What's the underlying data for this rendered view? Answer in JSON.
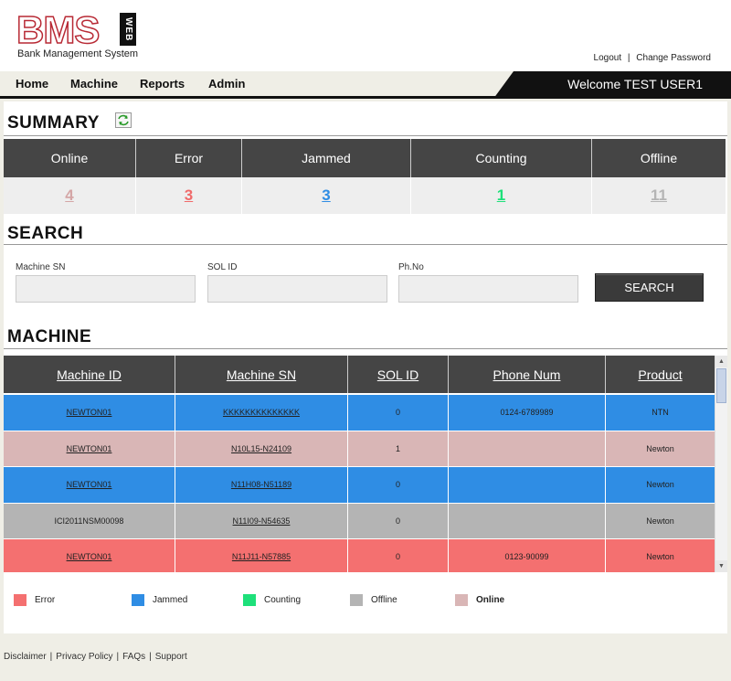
{
  "header": {
    "logo_text": "BMS",
    "logo_badge": "WEB",
    "logo_subtitle": "Bank Management System",
    "links": [
      "Logout",
      "Change Password"
    ],
    "separator": "|"
  },
  "nav": {
    "items": [
      "Home",
      "Machine",
      "Reports",
      "Admin"
    ],
    "welcome": "Welcome TEST USER1"
  },
  "summary": {
    "title": "SUMMARY",
    "columns": [
      "Online",
      "Error",
      "Jammed",
      "Counting",
      "Offline"
    ],
    "values": [
      "4",
      "3",
      "3",
      "1",
      "11"
    ],
    "value_colors": [
      "#d4a6a6",
      "#f06a6a",
      "#2f8de4",
      "#1ee07a",
      "#b5b5b5"
    ]
  },
  "search": {
    "title": "SEARCH",
    "labels": [
      "Machine SN",
      "SOL ID",
      "Ph.No"
    ],
    "values": [
      "",
      "",
      ""
    ],
    "button": "SEARCH"
  },
  "machine": {
    "title": "MACHINE",
    "columns": [
      "Machine ID",
      "Machine SN",
      "SOL ID",
      "Phone Num",
      "Product"
    ],
    "rows": [
      {
        "id": "NEWTON01",
        "sn": "KKKKKKKKKKKKKK",
        "sol": "0",
        "phone": "0124-6789989",
        "product": "NTN",
        "color": "#2f8de4"
      },
      {
        "id": "NEWTON01",
        "sn": "N10L15-N24109",
        "sol": "1",
        "phone": "",
        "product": "Newton",
        "color": "#d9b6b6"
      },
      {
        "id": "NEWTON01",
        "sn": "N11H08-N51189",
        "sol": "0",
        "phone": "",
        "product": "Newton",
        "color": "#2f8de4"
      },
      {
        "id": "ICI2011NSM00098",
        "sn": "N11I09-N54635",
        "sol": "0",
        "phone": "",
        "product": "Newton",
        "color": "#b4b4b4"
      },
      {
        "id": "NEWTON01",
        "sn": "N11J11-N57885",
        "sol": "0",
        "phone": "0123-90099",
        "product": "Newton",
        "color": "#f47070"
      }
    ]
  },
  "legend": [
    {
      "label": "Error",
      "color": "#f47070"
    },
    {
      "label": "Jammed",
      "color": "#2f8de4"
    },
    {
      "label": "Counting",
      "color": "#1ee07a"
    },
    {
      "label": "Offline",
      "color": "#b4b4b4"
    },
    {
      "label": "Online",
      "color": "#d9b6b6"
    }
  ],
  "footer": {
    "links": [
      "Disclaimer",
      "Privacy Policy",
      "FAQs",
      "Support"
    ],
    "separator": "|"
  }
}
